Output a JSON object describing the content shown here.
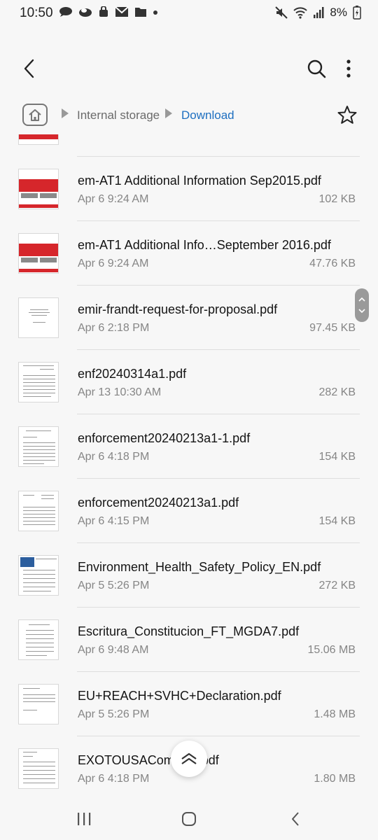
{
  "status_bar": {
    "time": "10:50",
    "battery": "8%",
    "icons_left": [
      "chat-bubble-icon",
      "cloud-icon",
      "bag-icon",
      "mail-icon",
      "folder-icon",
      "dot-icon"
    ],
    "icons_right": [
      "mute-icon",
      "wifi-icon",
      "signal-icon",
      "battery-icon"
    ]
  },
  "app_bar": {
    "icons": [
      "back-icon",
      "search-icon",
      "more-vert-icon"
    ]
  },
  "breadcrumb": {
    "items": [
      {
        "label": "Internal storage",
        "color": "#6b6b6b"
      },
      {
        "label": "Download",
        "color": "#1e6fc0"
      }
    ]
  },
  "files": [
    {
      "name": "em-AT1 Additional Information Sep2015.pdf",
      "date": "Apr 6 9:24 AM",
      "size": "102 KB",
      "thumb": "red"
    },
    {
      "name": "em-AT1 Additional Info…September 2016.pdf",
      "date": "Apr 6 9:24 AM",
      "size": "47.76 KB",
      "thumb": "red"
    },
    {
      "name": "emir-frandt-request-for-proposal.pdf",
      "date": "Apr 6 2:18 PM",
      "size": "97.45 KB",
      "thumb": "cover"
    },
    {
      "name": "enf20240314a1.pdf",
      "date": "Apr 13 10:30 AM",
      "size": "282 KB",
      "thumb": "text"
    },
    {
      "name": "enforcement20240213a1-1.pdf",
      "date": "Apr 6 4:18 PM",
      "size": "154 KB",
      "thumb": "text"
    },
    {
      "name": "enforcement20240213a1.pdf",
      "date": "Apr 6 4:15 PM",
      "size": "154 KB",
      "thumb": "text"
    },
    {
      "name": "Environment_Health_Safety_Policy_EN.pdf",
      "date": "Apr 5 5:26 PM",
      "size": "272 KB",
      "thumb": "blue"
    },
    {
      "name": "Escritura_Constitucion_FT_MGDA7.pdf",
      "date": "Apr 6 9:48 AM",
      "size": "15.06 MB",
      "thumb": "text"
    },
    {
      "name": "EU+REACH+SVHC+Declaration.pdf",
      "date": "Apr 5 5:26 PM",
      "size": "1.48 MB",
      "thumb": "sparse"
    },
    {
      "name": "EXOTOUSACom…-1.pdf",
      "date": "Apr 6 4:18 PM",
      "size": "1.80 MB",
      "thumb": "text"
    }
  ],
  "floating": {
    "icon": "chevron-up-icon"
  },
  "nav_bar": {
    "icons": [
      "recents-icon",
      "home-icon",
      "back-icon"
    ]
  },
  "colors": {
    "accent": "#1e6fc0",
    "background": "#f7f7f7",
    "secondary_text": "#858585",
    "thumb_red": "#d6262b"
  }
}
